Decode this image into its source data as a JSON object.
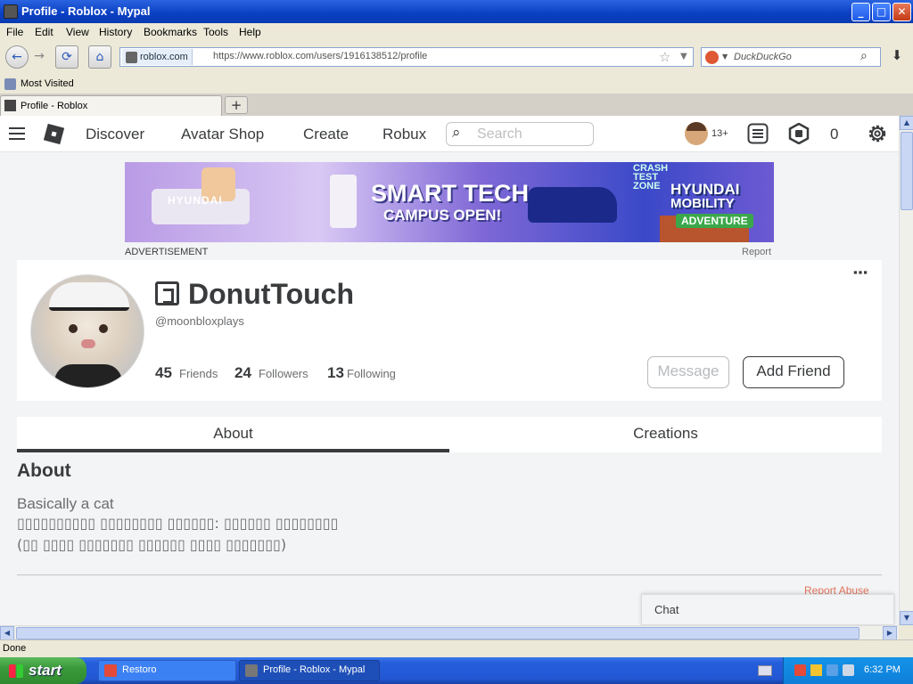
{
  "window": {
    "title": "Profile - Roblox - Mypal",
    "min": "_",
    "max": "□",
    "close": "✕"
  },
  "menu": [
    "File",
    "Edit",
    "View",
    "History",
    "Bookmarks",
    "Tools",
    "Help"
  ],
  "nav": {
    "back": "←",
    "forward": "→",
    "reload": "⟳",
    "home": "⌂",
    "site_label": "roblox.com",
    "url": "https://www.roblox.com/users/1916138512/profile",
    "search_placeholder": "DuckDuckGo",
    "download": "⬇"
  },
  "bookmarks": {
    "most_visited": "Most Visited"
  },
  "tabs": [
    {
      "label": "Profile - Roblox"
    }
  ],
  "new_tab": "+",
  "roblox_nav": {
    "links": [
      "Discover",
      "Avatar Shop",
      "Create",
      "Robux"
    ],
    "search_placeholder": "Search",
    "age_badge": "13+",
    "robux_count": "0"
  },
  "ad": {
    "label": "ADVERTISEMENT",
    "report": "Report",
    "banner": {
      "brand": "HYUNDAI",
      "title": "SMART TECH",
      "subtitle": "CAMPUS OPEN!",
      "right_line1": "HYUNDAI",
      "right_line2": "MOBILITY",
      "right_badge": "ADVENTURE",
      "crash_text": "CRASH TEST ZONE"
    }
  },
  "profile": {
    "display_name": "DonutTouch",
    "username": "@moonbloxplays",
    "stats": [
      {
        "count": "45",
        "label": "Friends"
      },
      {
        "count": "24",
        "label": "Followers"
      },
      {
        "count": "13",
        "label": "Following"
      }
    ],
    "message_button": "Message",
    "add_friend_button": "Add Friend",
    "more": "▪▪▪"
  },
  "profile_tabs": [
    "About",
    "Creations"
  ],
  "about": {
    "heading": "About",
    "line1": "Basically a cat",
    "line2": "▯▯▯▯▯▯▯▯▯▯ ▯▯▯▯▯▯▯▯ ▯▯▯▯▯▯: ▯▯▯▯▯▯ ▯▯▯▯▯▯▯▯",
    "line3": "(▯▯ ▯▯▯▯ ▯▯▯▯▯▯▯ ▯▯▯▯▯▯ ▯▯▯▯ ▯▯▯▯▯▯▯)",
    "report_abuse": "Report Abuse"
  },
  "chat": {
    "label": "Chat"
  },
  "status": {
    "text": "Done"
  },
  "taskbar": {
    "start": "start",
    "tasks": [
      "Restoro",
      "Profile - Roblox - Mypal"
    ],
    "clock": "6:32 PM"
  }
}
